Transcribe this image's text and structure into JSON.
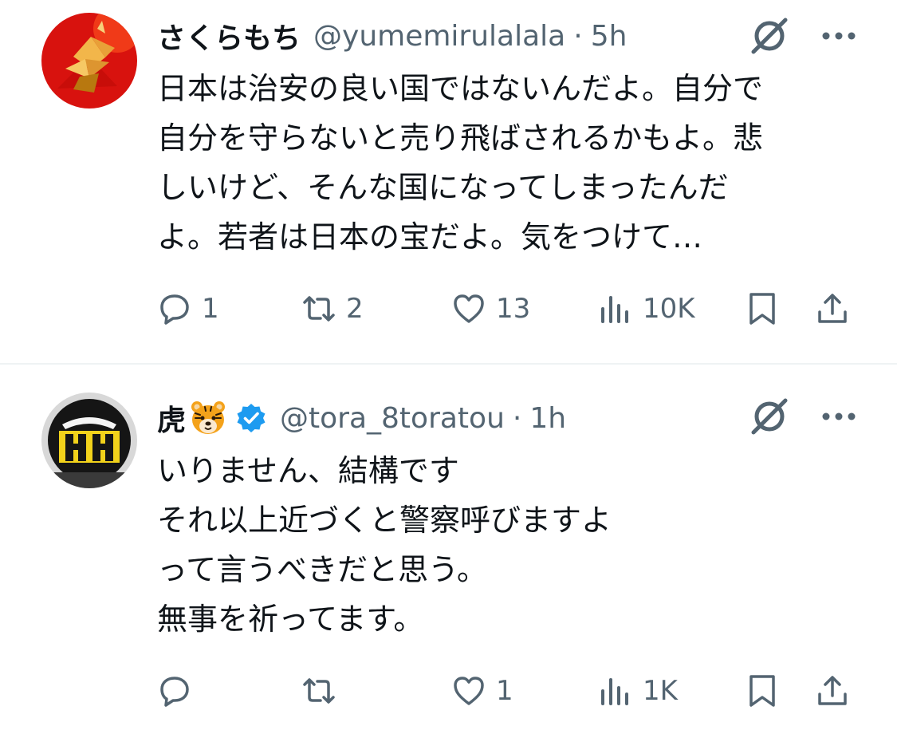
{
  "tweets": [
    {
      "display_name": "さくらもち",
      "handle": "@yumemirulalala",
      "separator": "·",
      "time": "5h",
      "lines": [
        "日本は治安の良い国ではないんだよ。自分で",
        "自分を守らないと売り飛ばされるかもよ。悲",
        "しいけど、そんな国になってしまったんだ",
        "よ。若者は日本の宝だよ。気をつけて…"
      ],
      "stats": {
        "replies": "1",
        "reposts": "2",
        "likes": "13",
        "views": "10K"
      }
    },
    {
      "display_name": "虎",
      "handle": "@tora_8toratou",
      "separator": "·",
      "time": "1h",
      "lines": [
        "いりません、結構です",
        "それ以上近づくと警察呼びますよ",
        "って言うべきだと思う。",
        "無事を祈ってます。"
      ],
      "stats": {
        "replies": "",
        "reposts": "",
        "likes": "1",
        "views": "1K"
      }
    }
  ],
  "icons": {
    "reply": "reply-icon",
    "repost": "repost-icon",
    "like": "like-icon",
    "views": "views-icon",
    "bookmark": "bookmark-icon",
    "share": "share-icon",
    "grok": "grok-icon",
    "more": "more-icon",
    "verified": "verified-badge-icon",
    "emoji": "tiger-face-emoji"
  },
  "colors": {
    "text": "#0f1419",
    "secondary": "#536471",
    "verified": "#1d9bf0",
    "divider": "#eff3f4"
  }
}
